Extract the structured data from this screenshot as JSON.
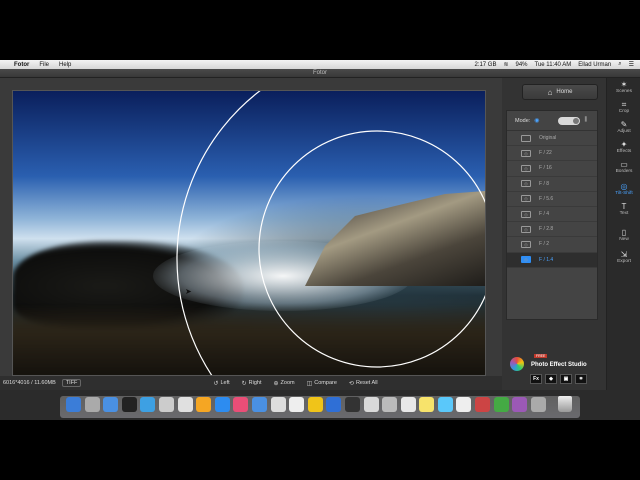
{
  "menubar": {
    "apple": "",
    "items": [
      "Fotor",
      "File",
      "Help"
    ],
    "status": [
      "2:17 GB",
      "94%",
      "Tue 11:40 AM",
      "Ellad Urman"
    ]
  },
  "window": {
    "title": "Fotor"
  },
  "status_bar": {
    "dimensions": "6016*4016 / 11.60MB",
    "format": "TIFF",
    "tools": [
      {
        "icon": "rotate-left-icon",
        "label": "Left"
      },
      {
        "icon": "rotate-right-icon",
        "label": "Right"
      },
      {
        "icon": "zoom-icon",
        "label": "Zoom"
      },
      {
        "icon": "compare-icon",
        "label": "Compare"
      },
      {
        "icon": "reset-icon",
        "label": "Reset All"
      }
    ]
  },
  "panel": {
    "home_label": "Home",
    "mode_label": "Mode:",
    "effects": [
      "Original",
      "F / 22",
      "F / 16",
      "F / 8",
      "F / 5.6",
      "F / 4",
      "F / 2.8",
      "F / 2",
      "F / 1.4"
    ],
    "selected_effect": "F / 1.4"
  },
  "toolbar": [
    {
      "icon": "scenes-icon",
      "label": "Scenes"
    },
    {
      "icon": "crop-icon",
      "label": "Crop"
    },
    {
      "icon": "adjust-icon",
      "label": "Adjust"
    },
    {
      "icon": "effects-icon",
      "label": "Effects"
    },
    {
      "icon": "borders-icon",
      "label": "Borders"
    },
    {
      "icon": "tilt-shift-icon",
      "label": "Tilt-Shift",
      "active": true
    },
    {
      "icon": "text-icon",
      "label": "Text"
    },
    {
      "icon": "new-icon",
      "label": "New"
    },
    {
      "icon": "export-icon",
      "label": "Export"
    }
  ],
  "promo": {
    "badge": "FREE",
    "name": "Photo Effect Studio",
    "icons": [
      "Fx",
      "◆",
      "▣",
      "⌗"
    ]
  },
  "colors": {
    "accent": "#4aa3ff",
    "panel": "#333333"
  }
}
